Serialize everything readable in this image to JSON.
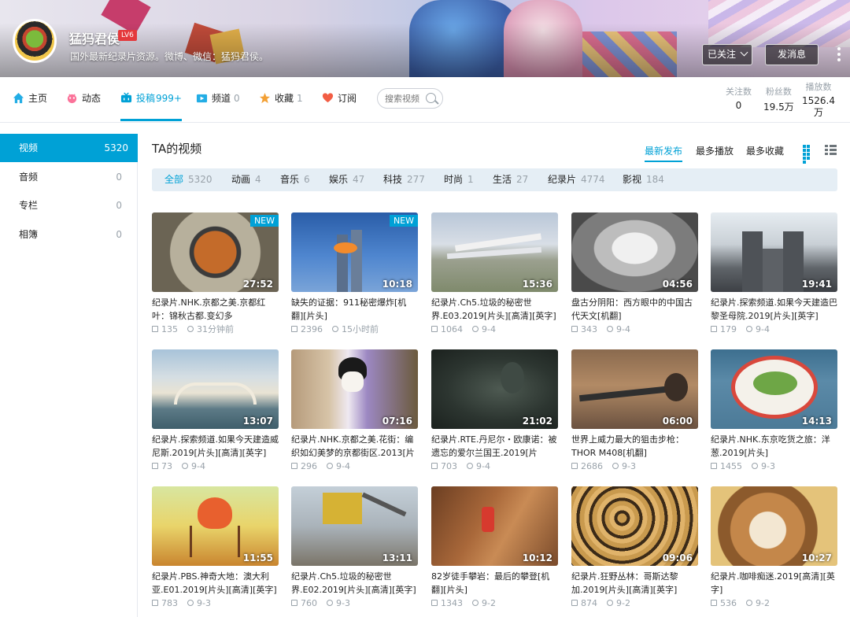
{
  "header": {
    "username": "猛犸君侯",
    "level": "LV6",
    "signature": "国外最新纪录片资源。微博、微信：猛犸君侯。",
    "follow_btn": "已关注",
    "message_btn": "发消息"
  },
  "nav": {
    "items": [
      {
        "label": "主页",
        "count": ""
      },
      {
        "label": "动态",
        "count": ""
      },
      {
        "label": "投稿",
        "count": "999+"
      },
      {
        "label": "频道",
        "count": "0"
      },
      {
        "label": "收藏",
        "count": "1"
      },
      {
        "label": "订阅",
        "count": ""
      }
    ],
    "search_placeholder": "搜索视频",
    "stats": [
      {
        "label": "关注数",
        "value": "0"
      },
      {
        "label": "粉丝数",
        "value": "19.5万"
      },
      {
        "label": "播放数",
        "value": "1526.4万"
      }
    ]
  },
  "sidebar": {
    "items": [
      {
        "label": "视频",
        "count": "5320"
      },
      {
        "label": "音频",
        "count": "0"
      },
      {
        "label": "专栏",
        "count": "0"
      },
      {
        "label": "相簿",
        "count": "0"
      }
    ]
  },
  "main": {
    "title": "TA的视频",
    "sort": [
      "最新发布",
      "最多播放",
      "最多收藏"
    ],
    "filters": [
      {
        "label": "全部",
        "count": "5320"
      },
      {
        "label": "动画",
        "count": "4"
      },
      {
        "label": "音乐",
        "count": "6"
      },
      {
        "label": "娱乐",
        "count": "47"
      },
      {
        "label": "科技",
        "count": "277"
      },
      {
        "label": "时尚",
        "count": "1"
      },
      {
        "label": "生活",
        "count": "27"
      },
      {
        "label": "纪录片",
        "count": "4774"
      },
      {
        "label": "影视",
        "count": "184"
      }
    ],
    "videos": [
      {
        "title": "纪录片.NHK.京都之美.京都红叶：锦秋古都.变幻多",
        "plays": "135",
        "time": "31分钟前",
        "duration": "27:52",
        "badge": "NEW"
      },
      {
        "title": "缺失的证据：911秘密爆炸[机翻][片头]",
        "plays": "2396",
        "time": "15小时前",
        "duration": "10:18",
        "badge": "NEW"
      },
      {
        "title": "纪录片.Ch5.垃圾的秘密世界.E03.2019[片头][高清][英字]",
        "plays": "1064",
        "time": "9-4",
        "duration": "15:36",
        "badge": ""
      },
      {
        "title": "盘古分阴阳：西方眼中的中国古代天文[机翻]",
        "plays": "343",
        "time": "9-4",
        "duration": "04:56",
        "badge": ""
      },
      {
        "title": "纪录片.探索频道.如果今天建造巴黎圣母院.2019[片头][英字]",
        "plays": "179",
        "time": "9-4",
        "duration": "19:41",
        "badge": ""
      },
      {
        "title": "纪录片.探索频道.如果今天建造威尼斯.2019[片头][高清][英字]",
        "plays": "73",
        "time": "9-4",
        "duration": "13:07",
        "badge": ""
      },
      {
        "title": "纪录片.NHK.京都之美.花街：编织如幻美梦的京都街区.2013[片",
        "plays": "296",
        "time": "9-4",
        "duration": "07:16",
        "badge": ""
      },
      {
        "title": "纪录片.RTE.丹尼尔・欧康诺：被遗忘的爱尔兰国王.2019[片",
        "plays": "703",
        "time": "9-4",
        "duration": "21:02",
        "badge": ""
      },
      {
        "title": "世界上威力最大的狙击步枪：THOR M408[机翻]",
        "plays": "2686",
        "time": "9-3",
        "duration": "06:00",
        "badge": ""
      },
      {
        "title": "纪录片.NHK.东京吃货之旅：洋葱.2019[片头]",
        "plays": "1455",
        "time": "9-3",
        "duration": "14:13",
        "badge": ""
      },
      {
        "title": "纪录片.PBS.神奇大地：澳大利亚.E01.2019[片头][高清][英字]",
        "plays": "783",
        "time": "9-3",
        "duration": "11:55",
        "badge": ""
      },
      {
        "title": "纪录片.Ch5.垃圾的秘密世界.E02.2019[片头][高清][英字]",
        "plays": "760",
        "time": "9-3",
        "duration": "13:11",
        "badge": ""
      },
      {
        "title": "82岁徒手攀岩：最后的攀登[机翻][片头]",
        "plays": "1343",
        "time": "9-2",
        "duration": "10:12",
        "badge": ""
      },
      {
        "title": "纪录片.狂野丛林：哥斯达黎加.2019[片头][高清][英字]",
        "plays": "874",
        "time": "9-2",
        "duration": "09:06",
        "badge": ""
      },
      {
        "title": "纪录片.咖啡痴迷.2019[高清][英字]",
        "plays": "536",
        "time": "9-2",
        "duration": "10:27",
        "badge": ""
      }
    ]
  },
  "colors": {
    "accent": "#00a1d6",
    "muted": "#99a2aa",
    "filter_bg": "#e5eef5"
  }
}
